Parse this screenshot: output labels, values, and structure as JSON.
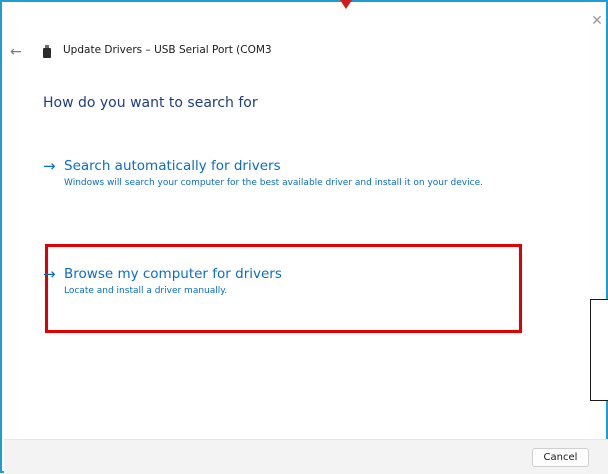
{
  "window": {
    "title": "Update Drivers – USB Serial Port (COM3",
    "close_icon": "✕",
    "back_icon": "←"
  },
  "heading": "How do you want to search for",
  "options": [
    {
      "arrow": "→",
      "title": "Search automatically for drivers",
      "description": "Windows will search your computer for the best available driver and install it on your device."
    },
    {
      "arrow": "→",
      "title": "Browse my computer for drivers",
      "description": "Locate and install a driver manually."
    }
  ],
  "footer": {
    "cancel_label": "Cancel"
  },
  "colors": {
    "accent": "#0a6cc9",
    "heading": "#1f3c88",
    "window_border": "#1f9bd6",
    "highlight": "#e00000",
    "footer_bg": "#f3f3f3"
  },
  "icons": {
    "close": "close-icon",
    "back": "back-arrow-icon",
    "device": "usb-device-icon",
    "option_arrow": "arrow-right-icon"
  }
}
